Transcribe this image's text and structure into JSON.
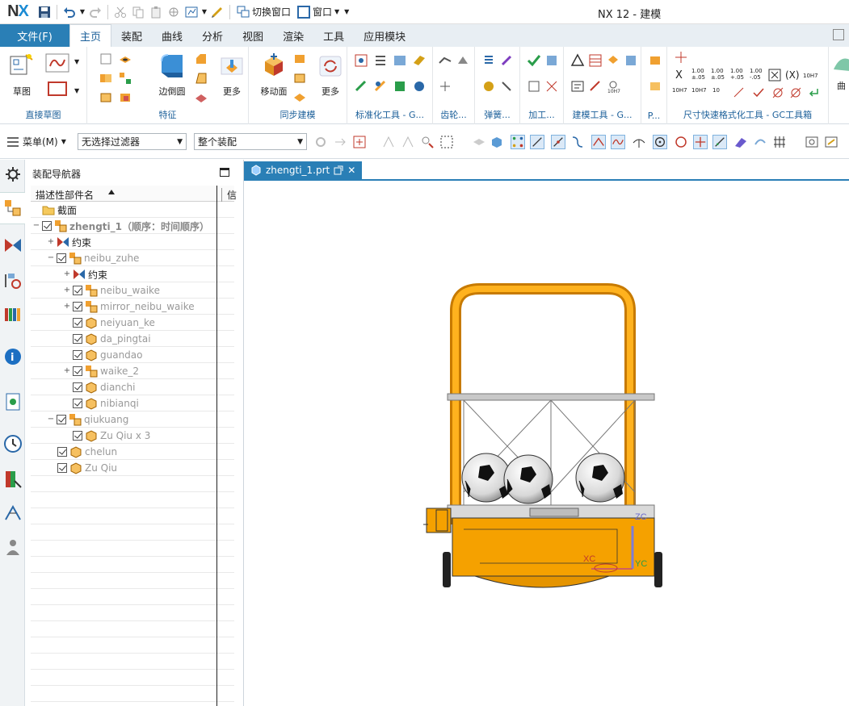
{
  "app": {
    "logo_a": "N",
    "logo_b": "X",
    "title": "NX 12 - 建模"
  },
  "quick_access": {
    "switch_window": "切换窗口",
    "window": "窗口"
  },
  "tabs": {
    "file": "文件(F)",
    "items": [
      "主页",
      "装配",
      "曲线",
      "分析",
      "视图",
      "渲染",
      "工具",
      "应用模块"
    ]
  },
  "ribbon": {
    "sketch_label": "草图",
    "direct_sketch_group": "直接草图",
    "feature_group": "特征",
    "edge_blend_label": "边倒圆",
    "more_label": "更多",
    "move_face_label": "移动面",
    "more2_label": "更多",
    "sync_group": "同步建模",
    "std_tools_group": "标准化工具 - G...",
    "gear_group": "齿轮...",
    "spring_group": "弹簧...",
    "machining_group": "加工...",
    "modeling_tools_group": "建模工具 - G...",
    "p_group": "P...",
    "dim_group": "尺寸快速格式化工具 - GC工具箱",
    "surface_label": "曲",
    "dim_texts": [
      "1.00\n±.05",
      "1.00\n±.05",
      "1.00\n+.05",
      "1.00\n-.05",
      "10H7",
      "10H7",
      "10H7",
      "10",
      "10H7"
    ]
  },
  "toolbar2": {
    "menu": "菜单(M)",
    "filter": "无选择过滤器",
    "scope": "整个装配"
  },
  "navigator": {
    "title": "装配导航器",
    "col_name": "描述性部件名",
    "col_info": "信",
    "rows": [
      {
        "label": "截面"
      },
      {
        "label": "zhengti_1（顺序：时间顺序）"
      },
      {
        "label": "约束"
      },
      {
        "label": "neibu_zuhe"
      },
      {
        "label": "约束"
      },
      {
        "label": "neibu_waike"
      },
      {
        "label": "mirror_neibu_waike"
      },
      {
        "label": "neiyuan_ke"
      },
      {
        "label": "da_pingtai"
      },
      {
        "label": "guandao"
      },
      {
        "label": "waike_2"
      },
      {
        "label": "dianchi"
      },
      {
        "label": "nibianqi"
      },
      {
        "label": "qiukuang"
      },
      {
        "label": "Zu Qiu x 3"
      },
      {
        "label": "chelun"
      },
      {
        "label": "Zu Qiu"
      }
    ]
  },
  "graphics": {
    "tab_name": "zhengti_1.prt",
    "axis_x": "XC",
    "axis_y": "YC",
    "axis_z": "ZC"
  },
  "colors": {
    "accent": "#2a7fb6",
    "cart": "#f5a100",
    "frame": "#a9a9a9"
  }
}
